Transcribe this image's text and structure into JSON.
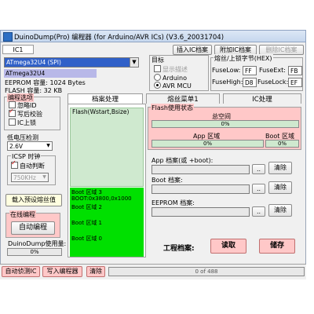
{
  "window": {
    "title": "DuinoDump(Pro) 编程器 (for Arduino/AVR ICs)    (V3.6_20031704)"
  },
  "header": {
    "ic_label": "IC1",
    "insert_btn": "插入IC档案",
    "add_btn": "附加IC档案",
    "delete_btn": "删除IC档案"
  },
  "chip": {
    "selected": "ATmega32U4 (SPI)",
    "name": "ATmega32U4",
    "eeprom_label": "EEPROM 容量:",
    "eeprom_value": "1024 Bytes",
    "flash_label": "FLASH 容量:",
    "flash_value": "32 KB"
  },
  "target": {
    "title": "目标",
    "options": [
      "显示描述",
      "Arduino",
      "AVR MCU"
    ]
  },
  "fuse": {
    "title": "熔丝/上锁字节(HEX)",
    "low_label": "FuseLow:",
    "low_value": "FF",
    "ext_label": "FuseExt:",
    "ext_value": "FB",
    "high_label": "FuseHigh:",
    "high_value": "D8",
    "lock_label": "FuseLock:",
    "lock_value": "EF"
  },
  "options": {
    "title": "编程选项",
    "items": [
      "忽略ID",
      "写后校验",
      "IC上锁"
    ]
  },
  "voltage": {
    "label": "低电压检测",
    "value": "2.6V"
  },
  "icsp": {
    "title": "ICSP 时钟",
    "auto_label": "自动判断",
    "clock_value": "750KHz"
  },
  "buttons": {
    "load_fuse": "载入预设熔丝值",
    "online_title": "在线编程",
    "auto_program": "自动编程",
    "auto_detect": "自动侦测IC",
    "write_prog": "写入编程器",
    "clear": "清除"
  },
  "usage": {
    "label": "DuinoDump使用量:",
    "value": "0%"
  },
  "tabs": [
    "档案处理",
    "熔丝菜单1",
    "IC处理"
  ],
  "flash_map": {
    "title": "Flash(Wstart,Bsize)",
    "rows": [
      "Boot 区域 3",
      "BOOT:0x3800,0x1000",
      "Boot 区域 2",
      "Boot 区域 1",
      "Boot 区域 0"
    ]
  },
  "flash_status": {
    "title": "Flash使用状态",
    "total_label": "总空间",
    "total_value": "0%",
    "app_label": "App 区域",
    "app_value": "0%",
    "boot_label": "Boot 区域",
    "boot_value": "0%"
  },
  "files": {
    "app_label": "App 档案(或 +boot):",
    "boot_label": "Boot 档案:",
    "eeprom_label": "EEPROM 档案:",
    "browse": "..",
    "clear": "清除"
  },
  "project": {
    "label": "工程档案:",
    "read": "读取",
    "save": "储存"
  },
  "status": {
    "progress_text": "0 of 488"
  },
  "colors": {
    "pink": "#ffc8c8",
    "green": "#00e000",
    "light_green": "#cfe9cf",
    "title_blue": "#c6d7ee"
  }
}
